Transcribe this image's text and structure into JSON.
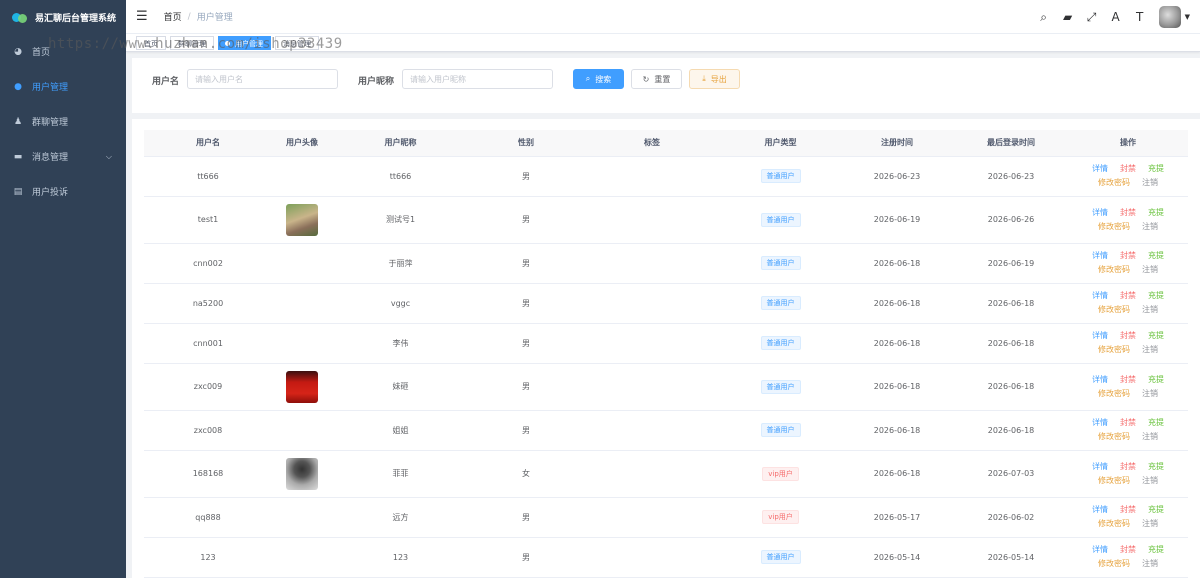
{
  "brand": {
    "title": "易汇聊后台管理系统"
  },
  "sidebar": {
    "items": [
      {
        "label": "首页",
        "icon": "dashboard-icon",
        "glyph": "◕",
        "active": false,
        "has_children": false
      },
      {
        "label": "用户管理",
        "icon": "user-icon",
        "glyph": "●",
        "active": true,
        "has_children": false
      },
      {
        "label": "群聊管理",
        "icon": "group-icon",
        "glyph": "♟",
        "active": false,
        "has_children": false
      },
      {
        "label": "消息管理",
        "icon": "message-icon",
        "glyph": "▬",
        "active": false,
        "has_children": true
      },
      {
        "label": "用户投诉",
        "icon": "complaint-icon",
        "glyph": "▤",
        "active": false,
        "has_children": false
      }
    ]
  },
  "header": {
    "breadcrumb": [
      "首页",
      "用户管理"
    ],
    "icons": [
      {
        "name": "search-icon",
        "glyph": "⌕"
      },
      {
        "name": "chat-icon",
        "glyph": "▰"
      },
      {
        "name": "fullscreen-icon",
        "glyph": "⤢"
      },
      {
        "name": "translate-icon",
        "glyph": "A"
      },
      {
        "name": "font-size-icon",
        "glyph": "T"
      }
    ]
  },
  "tags": [
    "首页",
    "群聊管理",
    "用户管理",
    "消息管理"
  ],
  "active_tag_index": 2,
  "watermark": "https://www.huzhan.com/ishop33439",
  "search": {
    "username_label": "用户名",
    "username_placeholder": "请输入用户名",
    "nickname_label": "用户昵称",
    "nickname_placeholder": "请输入用户昵称",
    "search_button": "搜索",
    "reset_button": "重置",
    "export_button": "导出"
  },
  "table": {
    "columns": [
      "用户名",
      "用户头像",
      "用户昵称",
      "性别",
      "标签",
      "用户类型",
      "注册时间",
      "最后登录时间",
      "操作"
    ],
    "actions": {
      "detail": "详情",
      "ban": "封禁",
      "charge": "充提",
      "change_password": "修改密码",
      "cancel": "注销"
    },
    "rows": [
      {
        "username": "tt666",
        "avatar": "",
        "nickname": "tt666",
        "gender": "男",
        "tag": "",
        "type": "普通用户",
        "vip": false,
        "registered": "2026-06-23",
        "last_login": "2026-06-23"
      },
      {
        "username": "test1",
        "avatar": "garden",
        "nickname": "测试号1",
        "gender": "男",
        "tag": "",
        "type": "普通用户",
        "vip": false,
        "registered": "2026-06-19",
        "last_login": "2026-06-26"
      },
      {
        "username": "cnn002",
        "avatar": "",
        "nickname": "于丽萍",
        "gender": "男",
        "tag": "",
        "type": "普通用户",
        "vip": false,
        "registered": "2026-06-18",
        "last_login": "2026-06-19"
      },
      {
        "username": "na5200",
        "avatar": "",
        "nickname": "vggc",
        "gender": "男",
        "tag": "",
        "type": "普通用户",
        "vip": false,
        "registered": "2026-06-18",
        "last_login": "2026-06-18"
      },
      {
        "username": "cnn001",
        "avatar": "",
        "nickname": "李伟",
        "gender": "男",
        "tag": "",
        "type": "普通用户",
        "vip": false,
        "registered": "2026-06-18",
        "last_login": "2026-06-18"
      },
      {
        "username": "zxc009",
        "avatar": "red",
        "nickname": "妹砸",
        "gender": "男",
        "tag": "",
        "type": "普通用户",
        "vip": false,
        "registered": "2026-06-18",
        "last_login": "2026-06-18"
      },
      {
        "username": "zxc008",
        "avatar": "",
        "nickname": "姐姐",
        "gender": "男",
        "tag": "",
        "type": "普通用户",
        "vip": false,
        "registered": "2026-06-18",
        "last_login": "2026-06-18"
      },
      {
        "username": "168168",
        "avatar": "portrait",
        "nickname": "菲菲",
        "gender": "女",
        "tag": "",
        "type": "vip用户",
        "vip": true,
        "registered": "2026-06-18",
        "last_login": "2026-07-03"
      },
      {
        "username": "qq888",
        "avatar": "",
        "nickname": "远方",
        "gender": "男",
        "tag": "",
        "type": "vip用户",
        "vip": true,
        "registered": "2026-05-17",
        "last_login": "2026-06-02"
      },
      {
        "username": "123",
        "avatar": "",
        "nickname": "123",
        "gender": "男",
        "tag": "",
        "type": "普通用户",
        "vip": false,
        "registered": "2026-05-14",
        "last_login": "2026-05-14"
      }
    ]
  }
}
